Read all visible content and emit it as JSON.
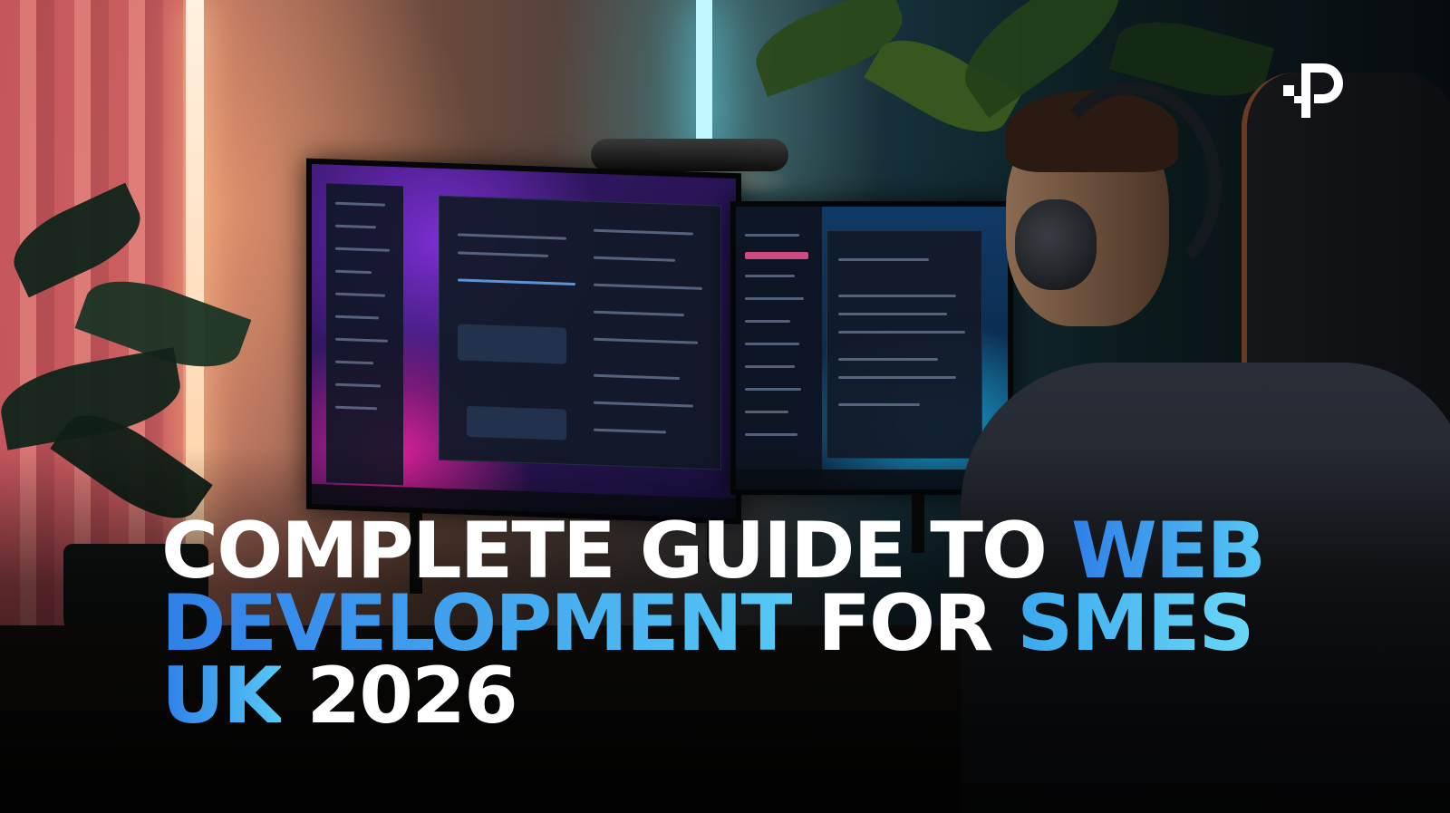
{
  "headline": {
    "line1": {
      "white": "COMPLETE GUIDE TO ",
      "accent": "WEB"
    },
    "line2": {
      "accent": "DEVELOPMENT",
      "white": " FOR ",
      "accent2": "SMES"
    },
    "line3": {
      "accent": "UK",
      "white": " 2026"
    }
  },
  "colors": {
    "text_white": "#ffffff",
    "accent_blue": "#2f7fe8",
    "accent_cyan": "#56c9f5"
  },
  "logo": {
    "icon": "p-brand-icon"
  }
}
